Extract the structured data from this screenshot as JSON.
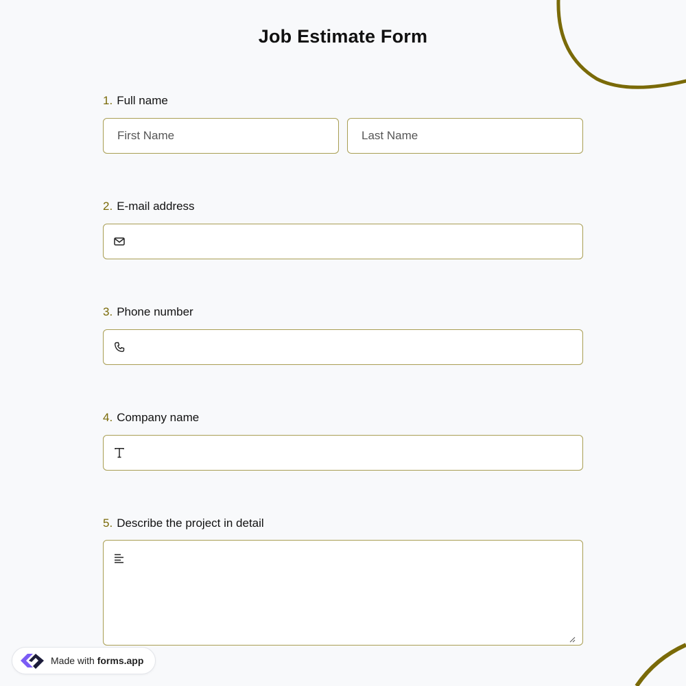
{
  "form": {
    "title": "Job Estimate Form"
  },
  "questions": [
    {
      "number": "1.",
      "label": "Full name"
    },
    {
      "number": "2.",
      "label": "E-mail address"
    },
    {
      "number": "3.",
      "label": "Phone number"
    },
    {
      "number": "4.",
      "label": "Company name"
    },
    {
      "number": "5.",
      "label": "Describe the project in detail"
    }
  ],
  "fields": {
    "first_name": {
      "placeholder": "First Name",
      "value": ""
    },
    "last_name": {
      "placeholder": "Last Name",
      "value": ""
    },
    "email": {
      "value": "",
      "icon": "envelope-icon"
    },
    "phone": {
      "value": "",
      "icon": "phone-icon"
    },
    "company": {
      "value": "",
      "icon": "text-type-icon"
    },
    "description": {
      "value": "",
      "icon": "paragraph-icon"
    }
  },
  "badge": {
    "prefix": "Made with ",
    "brand": "forms.app",
    "icon": "forms-app-logo"
  },
  "colors": {
    "accent": "#7a6a08",
    "field_border": "#a89d52",
    "background": "#f8f9fb",
    "logo_purple": "#7b5cf5",
    "logo_dark": "#1c1c3a"
  }
}
